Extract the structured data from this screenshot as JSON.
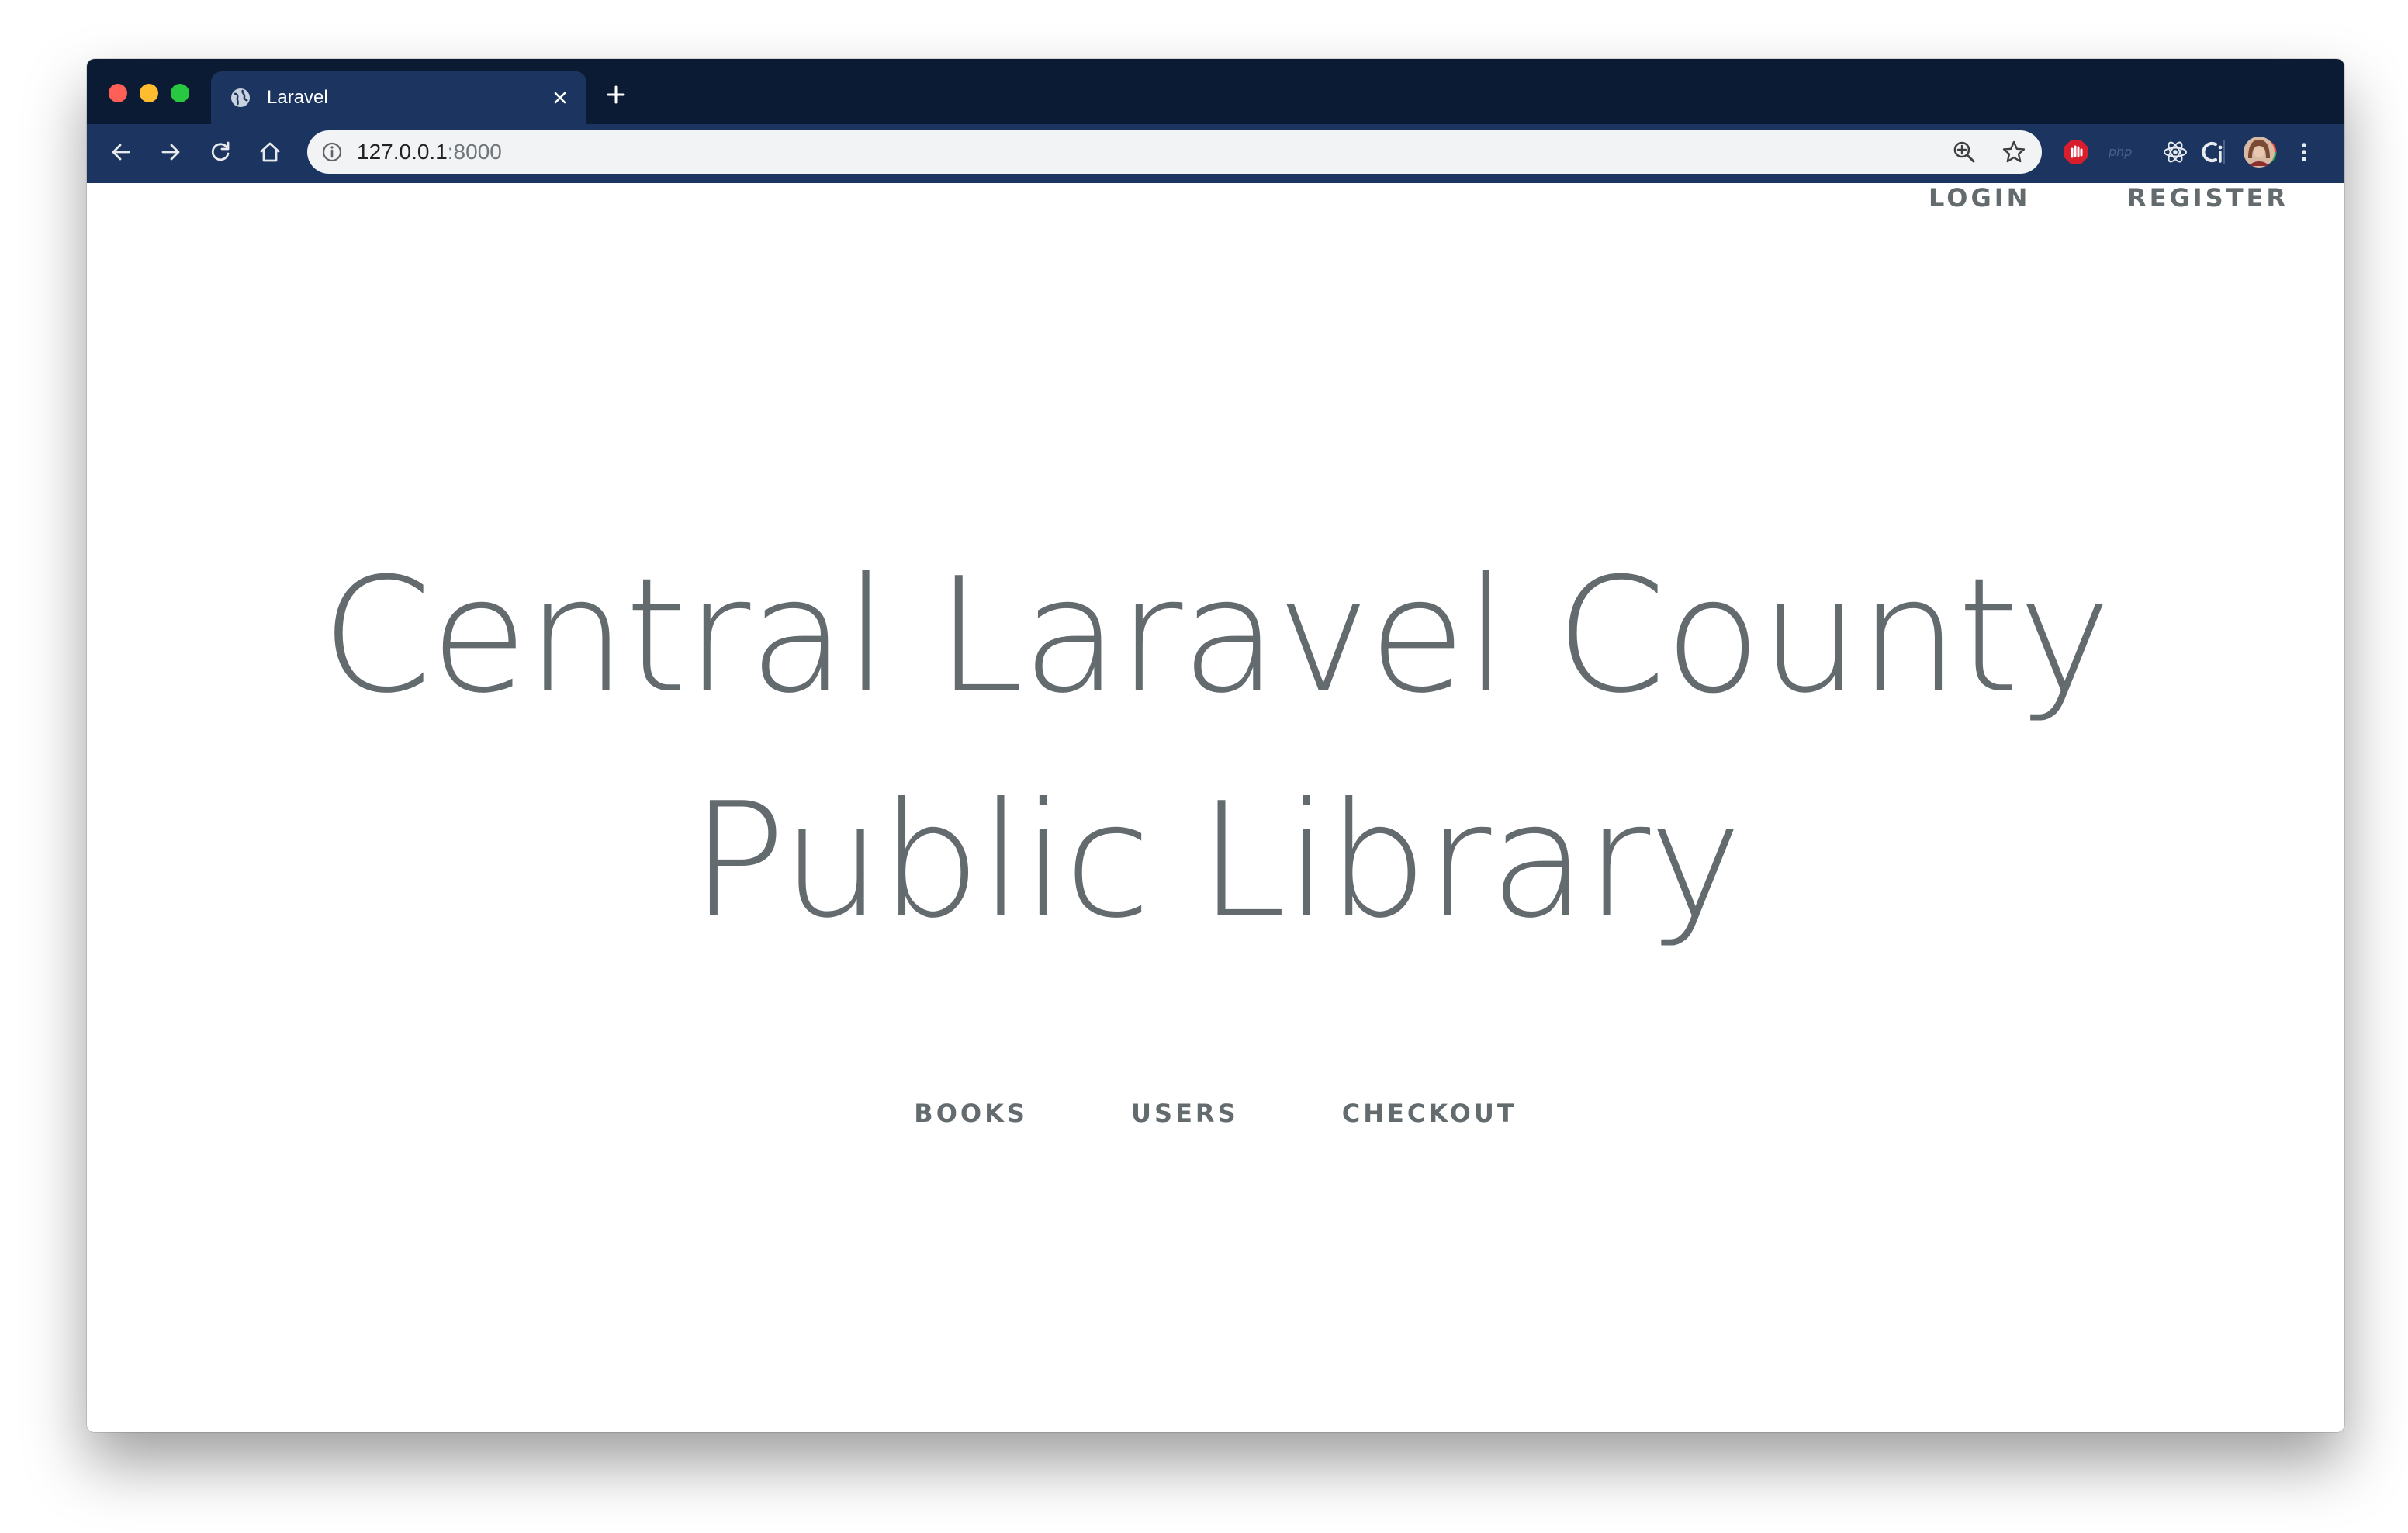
{
  "browser": {
    "tab": {
      "title": "Laravel"
    },
    "url": {
      "host": "127.0.0.1",
      "port": ":8000"
    },
    "icons": {
      "tab": "globe-icon",
      "close": "close-icon",
      "new_tab": "plus-icon",
      "back": "arrow-left-icon",
      "forward": "arrow-right-icon",
      "reload": "reload-icon",
      "home": "home-icon",
      "info": "info-icon",
      "zoom": "zoom-icon",
      "bookmark": "star-icon",
      "menu": "kebab-menu-icon"
    },
    "extensions": {
      "ext1": "stop-hand-icon",
      "ext2": "php-icon",
      "ext3": "react-icon",
      "ext4": "cj-icon",
      "ext5": "colorful-ring-icon",
      "avatar": "profile-avatar-icon",
      "php_label": "php"
    },
    "colors": {
      "titlebar": "#0c1b34",
      "toolbar": "#1b3560",
      "omnibox": "#f1f3f4",
      "text": "#636b6f"
    }
  },
  "page": {
    "top_nav": {
      "login": "Login",
      "register": "Register"
    },
    "title": "Central Laravel County Public Library",
    "links": {
      "books": "Books",
      "users": "Users",
      "checkout": "Checkout"
    }
  }
}
